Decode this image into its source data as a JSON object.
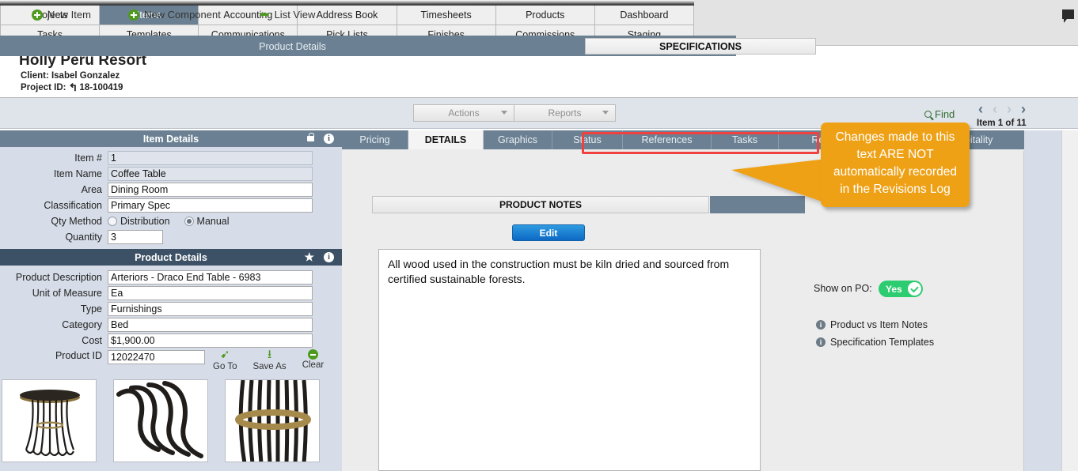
{
  "nav": {
    "row1": [
      "Projects",
      "Items",
      "Accounting",
      "Address Book",
      "Timesheets",
      "Products",
      "Dashboard"
    ],
    "row2": [
      "Tasks",
      "Templates",
      "Communications",
      "Pick Lists",
      "Finishes",
      "Commissions",
      "Staging"
    ],
    "active": "Items"
  },
  "project": {
    "title": "Holly Peru Resort",
    "client": "Client: Isabel Gonzalez",
    "project_id_label": "Project ID:",
    "project_id": "18-100419"
  },
  "toolbar": {
    "new_item": "New Item",
    "new_component": "New Component",
    "list_view": "List View",
    "actions": "Actions",
    "reports": "Reports",
    "find": "Find",
    "item_count": "Item 1 of 11"
  },
  "item_details": {
    "panel_title": "Item Details",
    "fields": [
      {
        "label": "Item #",
        "value": "1",
        "readonly": true,
        "width": "w-260"
      },
      {
        "label": "Item Name",
        "value": "Coffee Table",
        "readonly": true,
        "width": "w-260"
      },
      {
        "label": "Area",
        "value": "Dining Room",
        "readonly": false,
        "width": "w-260"
      },
      {
        "label": "Classification",
        "value": "Primary Spec",
        "readonly": false,
        "width": "w-260"
      }
    ],
    "qty_method_label": "Qty Method",
    "qty_method_options": [
      "Distribution",
      "Manual"
    ],
    "qty_method_selected": "Manual",
    "quantity_label": "Quantity",
    "quantity_value": "3"
  },
  "product_details": {
    "panel_title": "Product Details",
    "fields": [
      {
        "label": "Product Description",
        "value": "Arteriors - Draco End Table - 6983"
      },
      {
        "label": "Unit of Measure",
        "value": "Ea"
      },
      {
        "label": "Type",
        "value": "Furnishings"
      },
      {
        "label": "Category",
        "value": "Bed"
      },
      {
        "label": "Cost",
        "value": "$1,900.00"
      }
    ],
    "product_id_label": "Product ID",
    "product_id_value": "12022470",
    "actions": [
      "Go To",
      "Save As",
      "Clear"
    ]
  },
  "tabs": {
    "items": [
      "Pricing",
      "DETAILS",
      "Graphics",
      "Status",
      "References",
      "Tasks",
      "Rev",
      "Hospitality"
    ],
    "active": "DETAILS"
  },
  "subtabs": {
    "items": [
      "Product Details",
      "SPECIFICATIONS"
    ],
    "active": "SPECIFICATIONS"
  },
  "notes": {
    "header": "PRODUCT NOTES",
    "edit_label": "Edit",
    "body": "All wood used in the construction must be kiln dried and sourced from certified sustainable forests."
  },
  "right_options": {
    "show_on_po_label": "Show on PO:",
    "show_on_po_value": "Yes",
    "links": [
      "Product vs Item Notes",
      "Specification Templates"
    ]
  },
  "callout": {
    "text": "Changes made to this text ARE NOT automatically recorded in the Revisions Log"
  },
  "colors": {
    "panel_header": "#6b8193",
    "panel_header_dark": "#3d5166",
    "callout": "#efa116",
    "highlight_box": "#f04040",
    "toggle_on": "#2ecc71",
    "accent_green": "#4e9a1f",
    "edit_button": "#0d68c4"
  }
}
